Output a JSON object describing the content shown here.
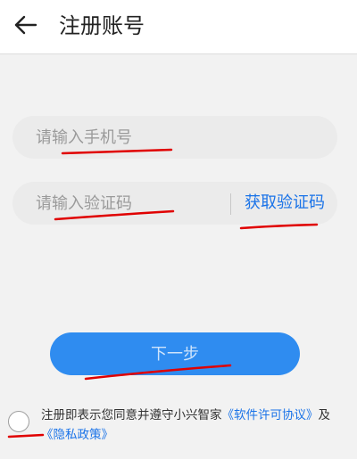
{
  "header": {
    "back_icon": "arrow-left-icon",
    "title": "注册账号"
  },
  "form": {
    "phone_placeholder": "请输入手机号",
    "code_placeholder": "请输入验证码",
    "get_code_label": "获取验证码",
    "next_label": "下一步"
  },
  "agreement": {
    "prefix": "注册即表示您同意并遵守小兴智家",
    "license_link": "《软件许可协议》",
    "and": "及",
    "privacy_link": "《隐私政策》"
  },
  "colors": {
    "accent": "#1a73e8",
    "button": "#2f8cf0",
    "annotation": "#e00000"
  }
}
